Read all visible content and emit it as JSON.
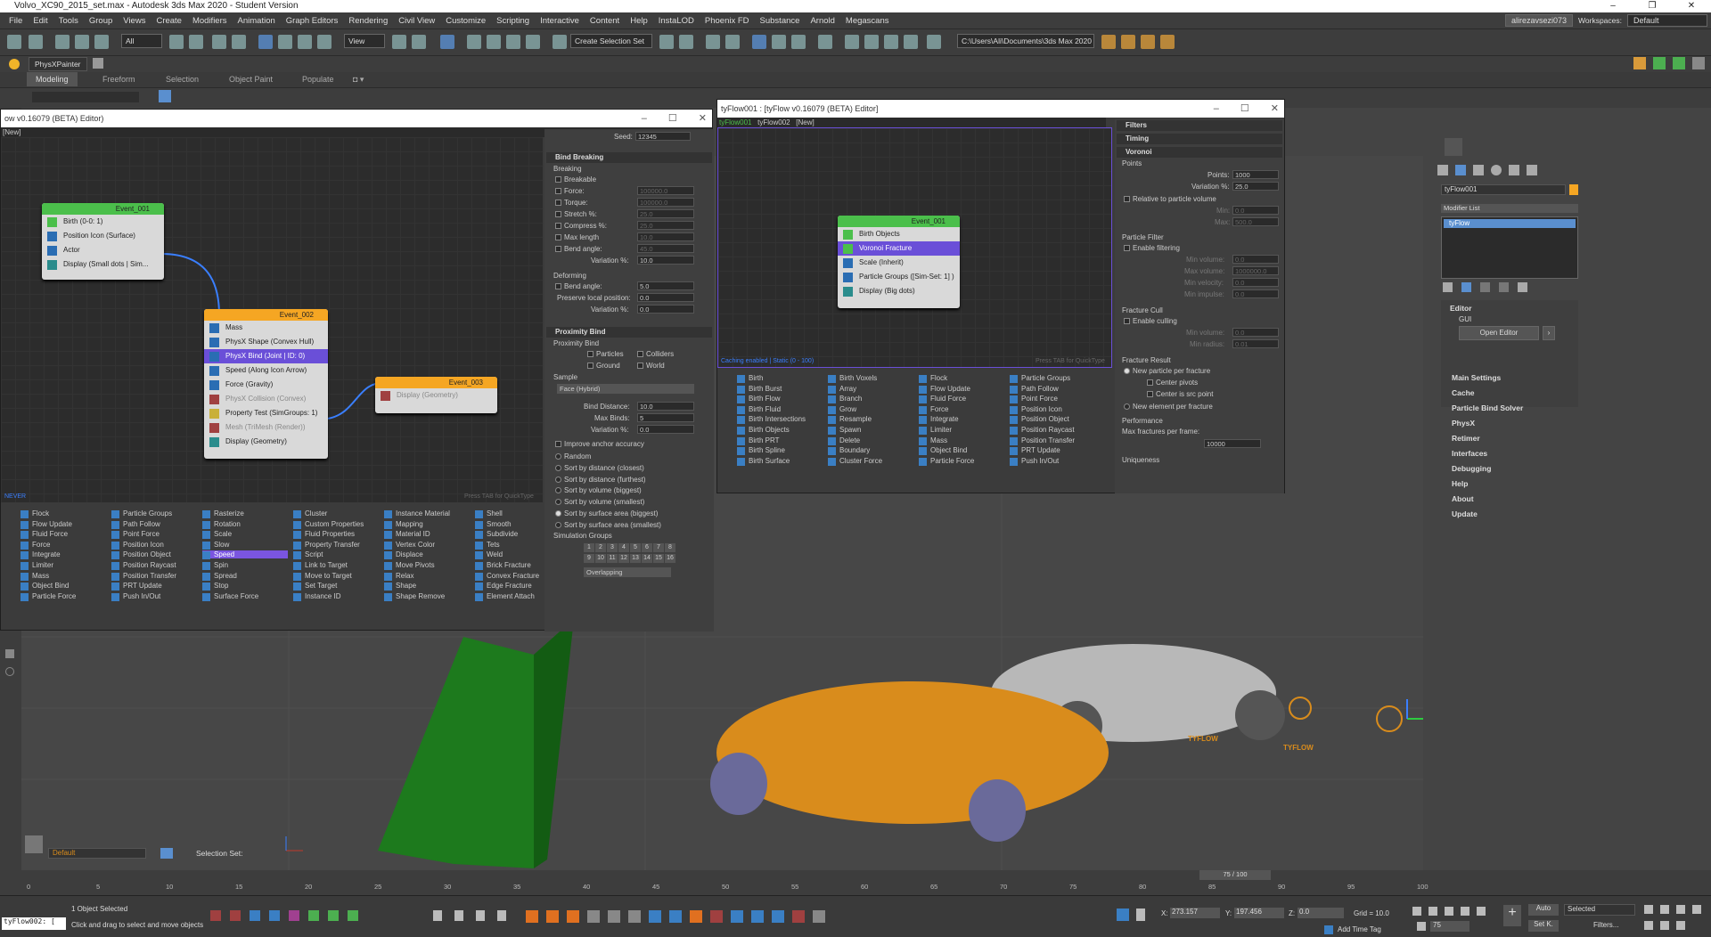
{
  "title": "Volvo_XC90_2015_set.max - Autodesk 3ds Max 2020 - Student Version",
  "menu": [
    "File",
    "Edit",
    "Tools",
    "Group",
    "Views",
    "Create",
    "Modifiers",
    "Animation",
    "Graph Editors",
    "Rendering",
    "Civil View",
    "Customize",
    "Scripting",
    "Interactive",
    "Content",
    "Help",
    "InstaLOD",
    "Phoenix FD",
    "Substance",
    "Arnold",
    "Megascans"
  ],
  "user": "alirezavsezi073",
  "workspaces_label": "Workspaces:",
  "workspace": "Default",
  "toolbar": {
    "filter": "All",
    "view": "View",
    "selection_set": "Create Selection Set",
    "path": "C:\\Users\\Ali\\Documents\\3ds Max 2020"
  },
  "physx_tab": "PhysXPainter",
  "ribbon_tabs": [
    "Modeling",
    "Freeform",
    "Selection",
    "Object Paint",
    "Populate"
  ],
  "editor1": {
    "title": "ow v0.16079 (BETA) Editor)",
    "tabs": "[New]",
    "footer_left": "NEVER",
    "footer_right": "Press TAB for QuickType",
    "event1": {
      "name": "Event_001",
      "ops": [
        "Birth (0-0: 1)",
        "Position Icon (Surface)",
        "Actor",
        "Display (Small dots | Sim..."
      ]
    },
    "event2": {
      "name": "Event_002",
      "ops": [
        "Mass",
        "PhysX Shape (Convex Hull)",
        "PhysX Bind (Joint | ID: 0)",
        "Speed (Along Icon Arrow)",
        "Force (Gravity)",
        "PhysX Collision (Convex)",
        "Property Test (SimGroups: 1)",
        "Mesh (TriMesh (Render))",
        "Display (Geometry)"
      ]
    },
    "event3": {
      "name": "Event_003",
      "ops": [
        "Display (Geometry)"
      ]
    },
    "palette": [
      [
        "Flock",
        "Flow Update",
        "Fluid Force",
        "Force",
        "Integrate",
        "Limiter",
        "Mass",
        "Object Bind",
        "Particle Force"
      ],
      [
        "Particle Groups",
        "Path Follow",
        "Point Force",
        "Position Icon",
        "Position Object",
        "Position Raycast",
        "Position Transfer",
        "PRT Update",
        "Push In/Out"
      ],
      [
        "Rasterize",
        "Rotation",
        "Scale",
        "Slow",
        "Speed",
        "Spin",
        "Spread",
        "Stop",
        "Surface Force"
      ],
      [
        "Cluster",
        "Custom Properties",
        "Fluid Properties",
        "Property Transfer",
        "Script",
        "Link to Target",
        "Move to Target",
        "Set Target",
        "Instance ID"
      ],
      [
        "Instance Material",
        "Mapping",
        "Material ID",
        "Vertex Color",
        "Displace",
        "Move Pivots",
        "Relax",
        "Shape",
        "Shape Remove"
      ],
      [
        "Shell",
        "Smooth",
        "Subdivide",
        "Tets",
        "Weld",
        "Brick Fracture",
        "Convex Fracture",
        "Edge Fracture",
        "Element Attach"
      ]
    ],
    "params": {
      "seed_label": "Seed:",
      "seed": "12345",
      "bind_breaking": "Bind Breaking",
      "breaking": "Breaking",
      "breakable": "Breakable",
      "force": "Force:",
      "force_v": "100000.0",
      "torque": "Torque:",
      "torque_v": "100000.0",
      "stretch": "Stretch %:",
      "stretch_v": "25.0",
      "compress": "Compress %:",
      "compress_v": "25.0",
      "maxlen": "Max length",
      "maxlen_v": "10.0",
      "bendangle": "Bend angle:",
      "bendangle_v": "45.0",
      "variation": "Variation %:",
      "variation_v": "10.0",
      "deforming": "Deforming",
      "def_bend": "Bend angle:",
      "def_bend_v": "5.0",
      "preserve": "Preserve local position:",
      "preserve_v": "0.0",
      "def_var": "Variation %:",
      "def_var_v": "0.0",
      "prox_bind": "Proximity Bind",
      "prox_bind2": "Proximity Bind",
      "particles": "Particles",
      "colliders": "Colliders",
      "ground": "Ground",
      "world": "World",
      "sample": "Sample",
      "sample_v": "Face (Hybrid)",
      "bind_dist": "Bind Distance:",
      "bind_dist_v": "10.0",
      "max_binds": "Max Binds:",
      "max_binds_v": "5",
      "prox_var": "Variation %:",
      "prox_var_v": "0.0",
      "improve": "Improve anchor accuracy",
      "sorts": [
        "Random",
        "Sort by distance (closest)",
        "Sort by distance (furthest)",
        "Sort by volume (biggest)",
        "Sort by volume (smallest)",
        "Sort by surface area (biggest)",
        "Sort by surface area (smallest)"
      ],
      "sim_groups": "Simulation Groups",
      "groups": [
        "1",
        "2",
        "3",
        "4",
        "5",
        "6",
        "7",
        "8",
        "9",
        "10",
        "11",
        "12",
        "13",
        "14",
        "15",
        "16"
      ],
      "overlap": "Overlapping"
    }
  },
  "editor2": {
    "title": "tyFlow001 : [tyFlow v0.16079 (BETA) Editor]",
    "tabs": [
      "tyFlow001",
      "tyFlow002",
      "[New]"
    ],
    "footer_left": "Caching enabled | Static (0 - 100)",
    "footer_right": "Press TAB for QuickType",
    "event": {
      "name": "Event_001",
      "ops": [
        "Birth Objects",
        "Voronoi Fracture",
        "Scale (Inherit)",
        "Particle Groups ([Sim-Set: 1] )",
        "Display (Big dots)"
      ]
    },
    "palette": [
      [
        "Birth",
        "Birth Burst",
        "Birth Flow",
        "Birth Fluid",
        "Birth Intersections",
        "Birth Objects",
        "Birth PRT",
        "Birth Spline",
        "Birth Surface"
      ],
      [
        "Birth Voxels",
        "Array",
        "Branch",
        "Grow",
        "Resample",
        "Spawn",
        "Delete",
        "Boundary",
        "Cluster Force"
      ],
      [
        "Flock",
        "Flow Update",
        "Fluid Force",
        "Force",
        "Integrate",
        "Limiter",
        "Mass",
        "Object Bind",
        "Particle Force"
      ],
      [
        "Particle Groups",
        "Path Follow",
        "Point Force",
        "Position Icon",
        "Position Object",
        "Position Raycast",
        "Position Transfer",
        "PRT Update",
        "Push In/Out"
      ]
    ],
    "params": {
      "filters": "Filters",
      "timing": "Timing",
      "voronoi": "Voronoi",
      "points": "Points",
      "points_l": "Points:",
      "points_v": "1000",
      "variation": "Variation %:",
      "variation_v": "25.0",
      "relative": "Relative to particle volume",
      "min": "Min:",
      "min_v": "0.0",
      "max": "Max:",
      "max_v": "500.0",
      "pfilter": "Particle Filter",
      "enable_filter": "Enable filtering",
      "minvol": "Min volume:",
      "minvol_v": "0.0",
      "maxvol": "Max volume:",
      "maxvol_v": "1000000.0",
      "minvel": "Min velocity:",
      "minvel_v": "0.0",
      "minimp": "Min impulse:",
      "minimp_v": "0.0",
      "fcull": "Fracture Cull",
      "enable_cull": "Enable culling",
      "minvol2": "Min volume:",
      "minvol2_v": "0.0",
      "minrad": "Min radius:",
      "minrad_v": "0.01",
      "fresult": "Fracture Result",
      "newpart": "New particle per fracture",
      "centerpiv": "Center pivots",
      "centersrc": "Center is src point",
      "newelem": "New element per fracture",
      "perf": "Performance",
      "maxfrac": "Max fractures per frame:",
      "maxfrac_v": "10000",
      "uniq": "Uniqueness"
    }
  },
  "cmdpanel": {
    "object_name": "tyFlow001",
    "modifier_list": "Modifier List",
    "stack_item": "tyFlow",
    "editor": "Editor",
    "gui": "GUI",
    "open_editor": "Open Editor",
    "sections": [
      "Main Settings",
      "Cache",
      "Particle Bind Solver",
      "PhysX",
      "Retimer",
      "Interfaces",
      "Debugging",
      "Help",
      "About",
      "Update"
    ]
  },
  "viewport": {
    "layer": "Default",
    "selection_set": "Selection Set:",
    "label1": "TYFLOW",
    "label2": "TYFLOW"
  },
  "timeline": {
    "frame": "75 / 100",
    "ticks": [
      "0",
      "5",
      "10",
      "15",
      "20",
      "25",
      "30",
      "35",
      "40",
      "45",
      "50",
      "55",
      "60",
      "65",
      "70",
      "75",
      "80",
      "85",
      "90",
      "95",
      "100"
    ]
  },
  "status": {
    "script": "tyFlow002: [",
    "selected": "1 Object Selected",
    "hint": "Click and drag to select and move objects",
    "x_label": "X:",
    "x": "273.157",
    "y_label": "Y:",
    "y": "197.456",
    "z_label": "Z:",
    "z": "0.0",
    "grid": "Grid = 10.0",
    "time_tag": "Add Time Tag",
    "auto": "Auto",
    "selected_dd": "Selected",
    "frame": "75",
    "setk": "Set K.",
    "filters": "Filters..."
  }
}
